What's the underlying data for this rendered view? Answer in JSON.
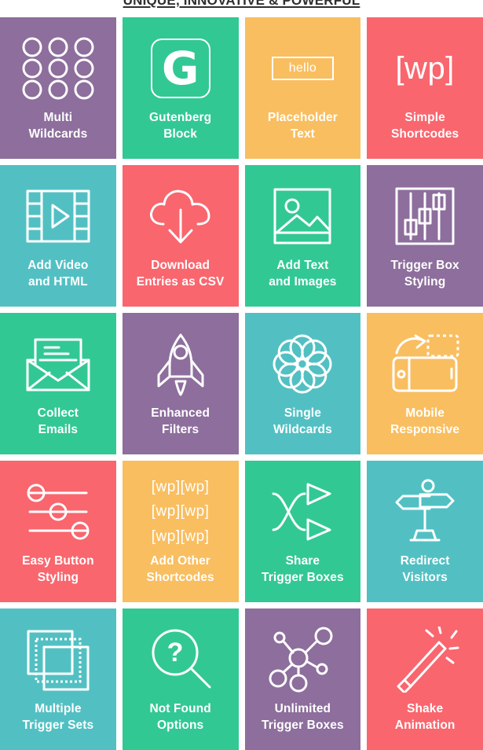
{
  "header": {
    "title": "UNIQUE, INNOVATIVE & POWERFUL"
  },
  "palette": {
    "purple": "#8d6e9c",
    "green": "#32c894",
    "orange": "#f9be60",
    "red": "#f9666e",
    "teal": "#52c0c3",
    "white": "#ffffff",
    "heading": "#2f2f2f"
  },
  "grid": {
    "columns": 4,
    "rows": 5,
    "tiles": [
      {
        "label": "Multi\nWildcards",
        "color": "#8d6e9c",
        "icon": "nine-circles-icon"
      },
      {
        "label": "Gutenberg\nBlock",
        "color": "#32c894",
        "icon": "gutenberg-g-icon",
        "glyph": "G"
      },
      {
        "label": "Placeholder\nText",
        "color": "#f9be60",
        "icon": "placeholder-box-icon",
        "glyph": "hello"
      },
      {
        "label": "Simple\nShortcodes",
        "color": "#f9666e",
        "icon": "wp-shortcode-icon",
        "glyph": "[wp]"
      },
      {
        "label": "Add Video\nand HTML",
        "color": "#52c0c3",
        "icon": "film-play-icon"
      },
      {
        "label": "Download\nEntries as CSV",
        "color": "#f9666e",
        "icon": "cloud-download-icon"
      },
      {
        "label": "Add Text\nand Images",
        "color": "#32c894",
        "icon": "image-picture-icon"
      },
      {
        "label": "Trigger Box\nStyling",
        "color": "#8d6e9c",
        "icon": "equalizer-sliders-icon"
      },
      {
        "label": "Collect\nEmails",
        "color": "#32c894",
        "icon": "envelope-letter-icon"
      },
      {
        "label": "Enhanced\nFilters",
        "color": "#8d6e9c",
        "icon": "rocket-icon"
      },
      {
        "label": "Single\nWildcards",
        "color": "#52c0c3",
        "icon": "flower-circles-icon"
      },
      {
        "label": "Mobile\nResponsive",
        "color": "#f9be60",
        "icon": "phone-rotate-icon"
      },
      {
        "label": "Easy Button\nStyling",
        "color": "#f9666e",
        "icon": "horizontal-sliders-icon"
      },
      {
        "label": "Add Other\nShortcodes",
        "color": "#f9be60",
        "icon": "wp-shortcode-stack-icon",
        "lines": [
          "[wp][wp]",
          "[wp][wp]",
          "[wp][wp]"
        ]
      },
      {
        "label": "Share\nTrigger Boxes",
        "color": "#32c894",
        "icon": "shuffle-arrows-icon"
      },
      {
        "label": "Redirect\nVisitors",
        "color": "#52c0c3",
        "icon": "signpost-icon"
      },
      {
        "label": "Multiple\nTrigger Sets",
        "color": "#52c0c3",
        "icon": "stacked-layers-icon"
      },
      {
        "label": "Not Found\nOptions",
        "color": "#32c894",
        "icon": "magnifier-question-icon",
        "glyph": "?"
      },
      {
        "label": "Unlimited\nTrigger Boxes",
        "color": "#8d6e9c",
        "icon": "network-nodes-icon"
      },
      {
        "label": "Shake\nAnimation",
        "color": "#f9666e",
        "icon": "magic-wand-icon"
      }
    ]
  }
}
